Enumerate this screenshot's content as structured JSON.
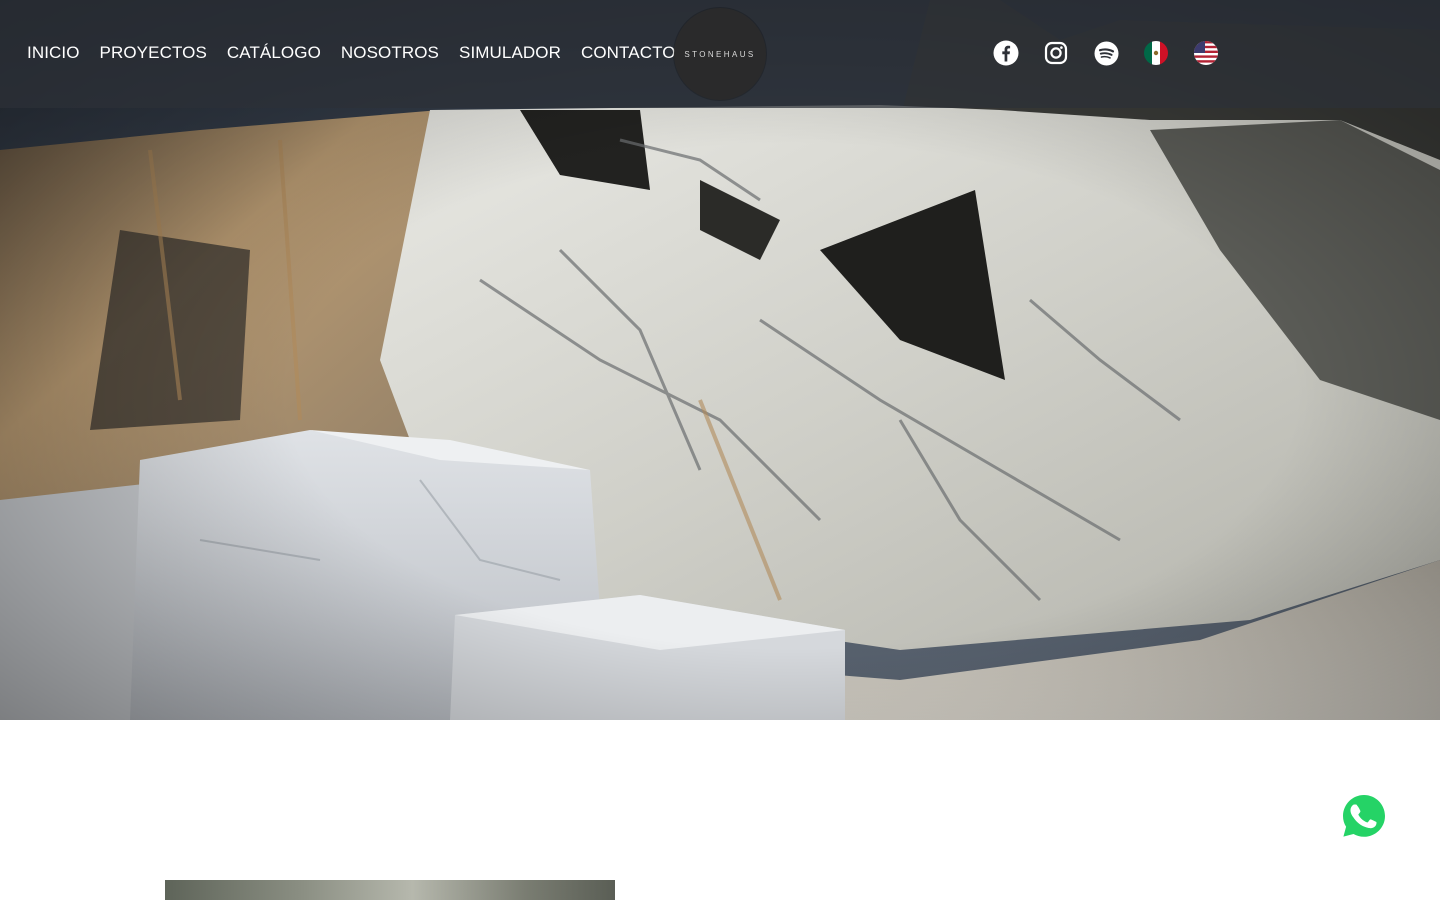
{
  "brand": {
    "logo_text": "STONEHAUS"
  },
  "nav": {
    "items": [
      "INICIO",
      "PROYECTOS",
      "CATÁLOGO",
      "NOSOTROS",
      "SIMULADOR",
      "CONTACTO"
    ]
  },
  "social": {
    "icons": [
      "facebook-icon",
      "instagram-icon",
      "spotify-icon",
      "mexico-flag-icon",
      "usa-flag-icon"
    ]
  },
  "hero": {
    "image": "marble quarry photo"
  },
  "colors": {
    "header_overlay": "#2d3037",
    "logo_bg": "#2a2a2b",
    "whatsapp_green": "#25d366",
    "text_white": "#ffffff"
  }
}
